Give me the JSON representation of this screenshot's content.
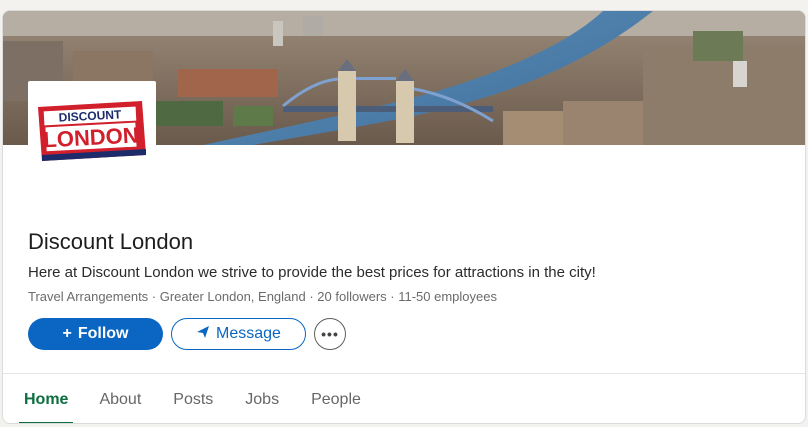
{
  "company": {
    "logo_text_top": "DISCOUNT",
    "logo_text_bottom": "LONDON",
    "name": "Discount London",
    "tagline": "Here at Discount London we strive to provide the best prices for attractions in the city!",
    "meta": "Travel Arrangements · Greater London, England · 20 followers · 11-50 employees"
  },
  "actions": {
    "follow_icon": "+",
    "follow_label": "Follow",
    "message_label": "Message",
    "more_label": "•••"
  },
  "tabs": [
    {
      "label": "Home",
      "active": true
    },
    {
      "label": "About",
      "active": false
    },
    {
      "label": "Posts",
      "active": false
    },
    {
      "label": "Jobs",
      "active": false
    },
    {
      "label": "People",
      "active": false
    }
  ],
  "colors": {
    "primary": "#0a66c2",
    "active_tab": "#0d6e3f"
  }
}
